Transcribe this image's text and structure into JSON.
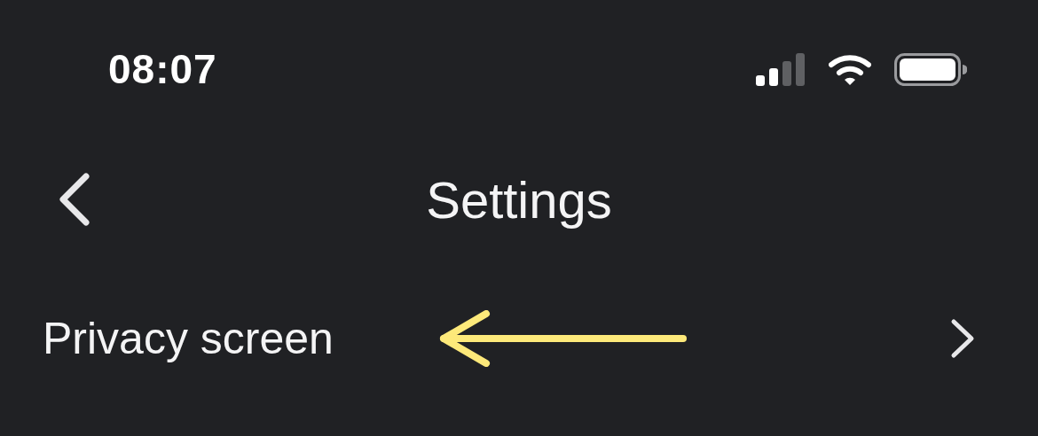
{
  "status_bar": {
    "time": "08:07"
  },
  "nav": {
    "title": "Settings"
  },
  "rows": [
    {
      "label": "Privacy screen"
    }
  ]
}
